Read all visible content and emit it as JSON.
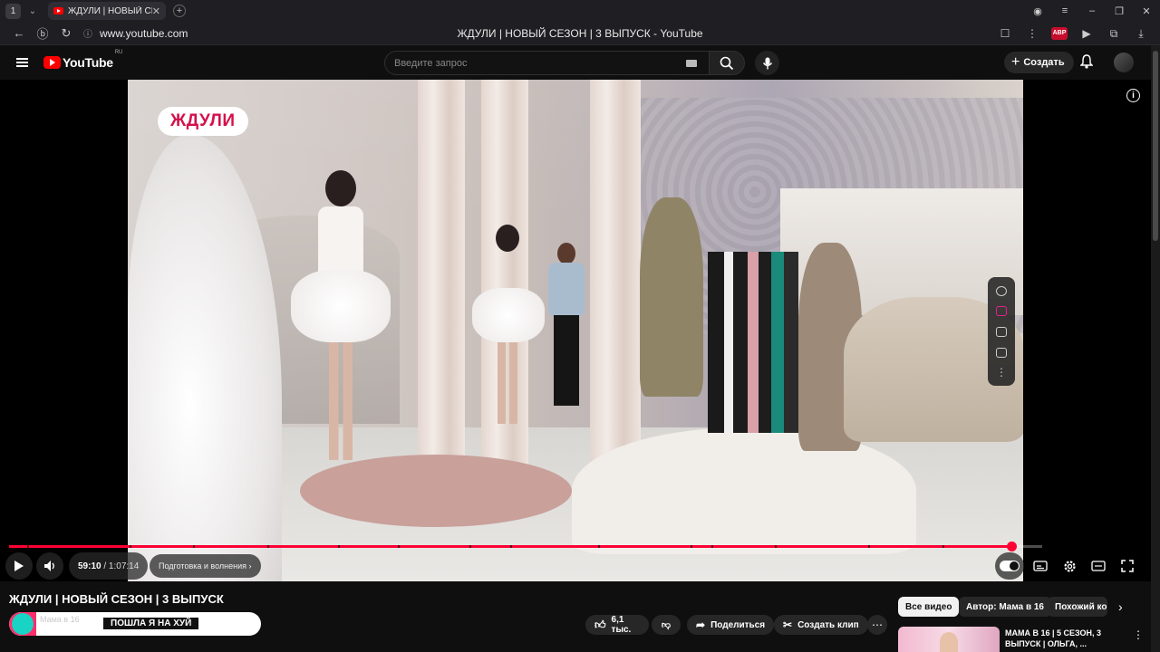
{
  "browser": {
    "tab_count": "1",
    "tab_title": "ЖДУЛИ | НОВЫЙ СЕЗ",
    "url": "www.youtube.com",
    "page_title": "ЖДУЛИ | НОВЫЙ СЕЗОН | 3 ВЫПУСК - YouTube",
    "abp_label": "ABP"
  },
  "header": {
    "logo_text": "YouTube",
    "logo_region": "RU",
    "search_placeholder": "Введите запрос",
    "create_label": "Создать"
  },
  "player": {
    "overlay_badge": "ЖДУЛИ",
    "current_time": "59:10",
    "duration": "/ 1:07:14",
    "chapter_label": "Подготовка и волнения",
    "progress_fraction": 0.97
  },
  "video": {
    "title": "ЖДУЛИ | НОВЫЙ СЕЗОН | 3 ВЫПУСК",
    "channel_name": "Мама в 16",
    "banner_message": "ПОШЛА Я НА ХУЙ",
    "like_count": "6,1 тыс.",
    "share_label": "Поделиться",
    "clip_label": "Создать клип"
  },
  "recommendations": {
    "chips": [
      "Все видео",
      "Автор: Мама в 16",
      "Похожий контент"
    ],
    "first_title": "МАМА В 16 | 5 СЕЗОН, 3 ВЫПУСК | ОЛЬГА, ..."
  },
  "colors": {
    "accent": "#ff0033",
    "badge_text": "#d4114b",
    "background": "#0f0f0f"
  }
}
